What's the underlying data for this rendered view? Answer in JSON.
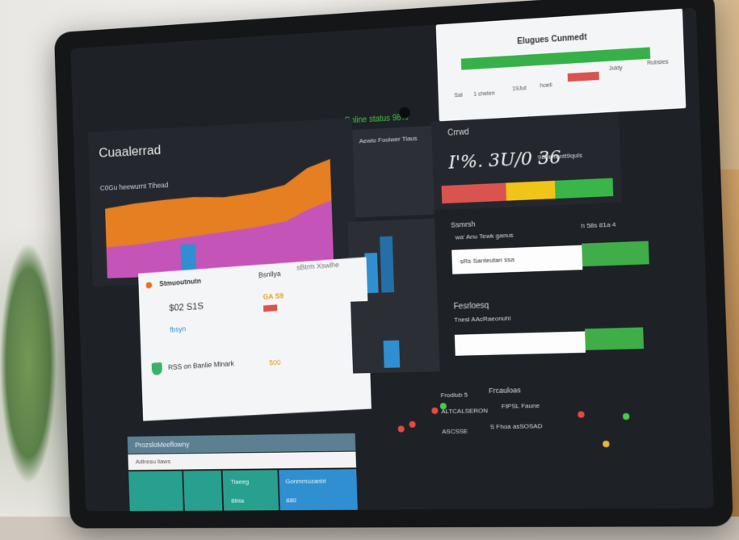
{
  "status": {
    "indicator_text": "Online status 98%"
  },
  "dashboard": {
    "title": "Cuaalerrad",
    "chart_subtitle": "C0Gu heewurnt Tihead"
  },
  "summary": {
    "title": "Elugues Cunmedt",
    "labels": [
      "Sal",
      "1 chelen",
      "19Jut",
      "hoeli",
      "Juldy",
      "Rubsles"
    ]
  },
  "gauge": {
    "label": "Crrwd",
    "value": "I'%. 3U/0 36",
    "side_label": "98ffe tentt9quls"
  },
  "mid_labels": {
    "a": "Aewlo Foolwer Tiaus",
    "b": "Ssmrsh",
    "c": "wa' Anu Tewk ganus",
    "d": "h 58s 81a 4"
  },
  "row_card": {
    "text": "sRs Santeutan ssa"
  },
  "list": {
    "header": "Stmuoutnutn",
    "col_label": "Bsnllya",
    "col_right": "sBtrm Xswlhe",
    "value_row": "$02 S1S",
    "value_accent": "GA S9",
    "row2_label": "fbsyn",
    "item_label": "RSS on Banlie Mlnark",
    "item_value": "$00"
  },
  "feature": {
    "label": "Fesrloesq",
    "sub": "Tnesl AAcRaeonuhl"
  },
  "bottom": {
    "bar_title": "ProzsloMeeflowny",
    "white_label": "Adlresu liaws",
    "tile_labels": [
      "",
      "",
      "Tiaeeg",
      "Gonmmuzanbt"
    ],
    "tile_values": [
      "",
      "",
      "8ihia",
      "880"
    ]
  },
  "scatter": {
    "label1": "Frodlub 5",
    "label2": "Frcauloas",
    "sub1": "ALTCALSERON",
    "sub2": "FIPSL Faune",
    "sub3": "ASCSSE",
    "sub4": "S Fhoa asSOSAD",
    "points": [
      {
        "x": 0.08,
        "y": 0.55,
        "color": "#e84c3d"
      },
      {
        "x": 0.12,
        "y": 0.5,
        "color": "#e84c3d"
      },
      {
        "x": 0.2,
        "y": 0.35,
        "color": "#e84c3d"
      },
      {
        "x": 0.23,
        "y": 0.3,
        "color": "#4ccb4f"
      },
      {
        "x": 0.7,
        "y": 0.42,
        "color": "#e84c3d"
      },
      {
        "x": 0.85,
        "y": 0.45,
        "color": "#4ccb4f"
      },
      {
        "x": 0.78,
        "y": 0.75,
        "color": "#f0b43a"
      }
    ]
  },
  "colors": {
    "accent_green": "#37b04a",
    "accent_red": "#d9534f",
    "accent_orange": "#ef6c22",
    "accent_blue": "#2f8fd1"
  }
}
